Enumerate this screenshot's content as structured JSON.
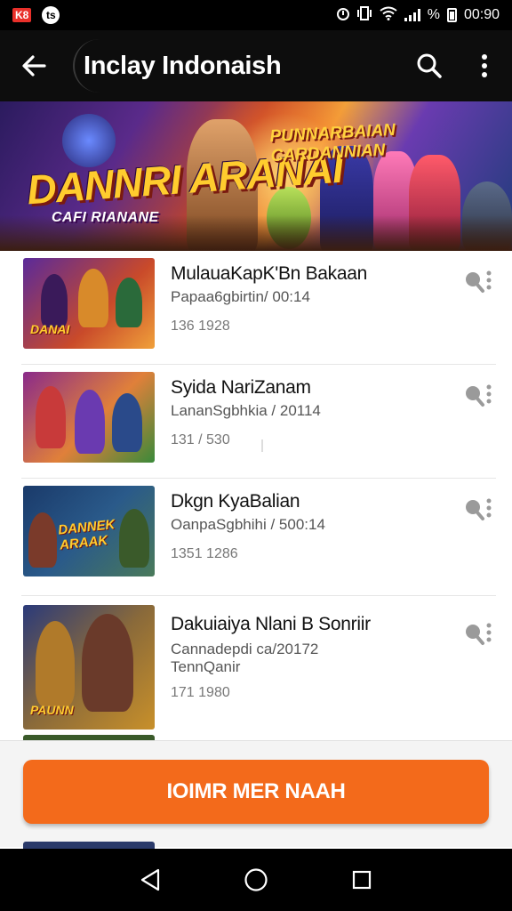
{
  "status_bar": {
    "badge": "K8",
    "notif": "ts",
    "time": "00:90",
    "signal_text": "%"
  },
  "app_bar": {
    "title": "Inclay Indonaish"
  },
  "banner": {
    "logo": "DANNRI ARANAI",
    "subtitle": "CAFI RIANANE",
    "tagline": "PUNNARBAIAN CARDANNIAN"
  },
  "items": [
    {
      "title": "MulauaKapK'Bn Bakaan",
      "subtitle": "Papaa6gbirtin/ 00:14",
      "subtitle2": "",
      "meta": "136 1928",
      "thumb_logo": "DANAI",
      "colors": [
        "#5a2a9a",
        "#c94a2a"
      ]
    },
    {
      "title": "Syida NariZanam",
      "subtitle": "LananSgbhkia / 20114",
      "subtitle2": "",
      "meta": "131 / 530",
      "thumb_logo": "",
      "colors": [
        "#8a2a8a",
        "#e0803a"
      ]
    },
    {
      "title": "Dkgn KyaBalian",
      "subtitle": "OanpaSgbhihi / 500:14",
      "subtitle2": "",
      "meta": "1351 1286",
      "thumb_logo": "DANNEK ARAAK",
      "colors": [
        "#1a3a6a",
        "#4a7a5a"
      ]
    },
    {
      "title": "Dakuiaiya Nlani B Sonriir",
      "subtitle": "Cannadepdi ca/20172",
      "subtitle2": "TennQanir",
      "meta": "171 1980",
      "thumb_logo": "PAUNN",
      "colors": [
        "#2a3a7a",
        "#c8902a"
      ]
    }
  ],
  "cta": {
    "label": "IOIMR MER NAAH",
    "color": "#f36a1b"
  },
  "icons": {
    "back": "arrow-back-icon",
    "search": "search-icon",
    "more": "more-vert-icon",
    "item_action": "search-more-icon",
    "nav_back": "triangle-back-icon",
    "nav_home": "circle-home-icon",
    "nav_recents": "square-recents-icon"
  }
}
